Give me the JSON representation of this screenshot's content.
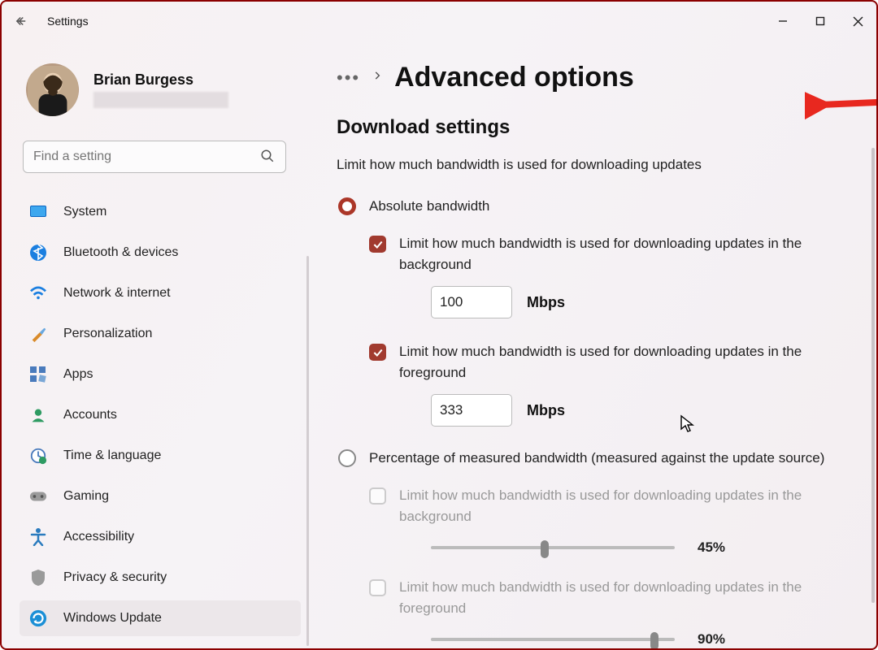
{
  "app": {
    "title": "Settings"
  },
  "user": {
    "name": "Brian Burgess"
  },
  "search": {
    "placeholder": "Find a setting"
  },
  "sidebar": {
    "items": [
      {
        "label": "System"
      },
      {
        "label": "Bluetooth & devices"
      },
      {
        "label": "Network & internet"
      },
      {
        "label": "Personalization"
      },
      {
        "label": "Apps"
      },
      {
        "label": "Accounts"
      },
      {
        "label": "Time & language"
      },
      {
        "label": "Gaming"
      },
      {
        "label": "Accessibility"
      },
      {
        "label": "Privacy & security"
      },
      {
        "label": "Windows Update"
      }
    ]
  },
  "breadcrumb": {
    "page": "Advanced options"
  },
  "section": {
    "title": "Download settings",
    "desc": "Limit how much bandwidth is used for downloading updates"
  },
  "radio": {
    "absolute": "Absolute bandwidth",
    "percentage": "Percentage of measured bandwidth (measured against the update source)"
  },
  "abs": {
    "bg_label": "Limit how much bandwidth is used for downloading updates in the background",
    "bg_value": "100",
    "fg_label": "Limit how much bandwidth is used for downloading updates in the foreground",
    "fg_value": "333",
    "unit": "Mbps"
  },
  "pct": {
    "bg_label": "Limit how much bandwidth is used for downloading updates in the background",
    "bg_value": "45%",
    "bg_pct": 45,
    "fg_label": "Limit how much bandwidth is used for downloading updates in the foreground",
    "fg_value": "90%",
    "fg_pct": 90
  }
}
